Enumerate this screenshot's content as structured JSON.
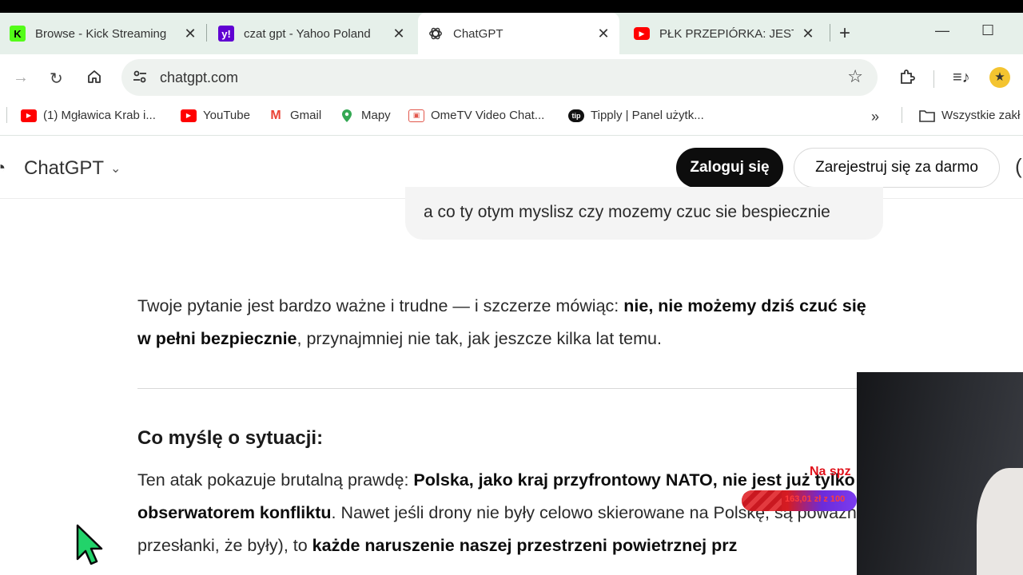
{
  "tabs": [
    {
      "title": "Browse - Kick Streaming",
      "favicon": "kick-icon",
      "favicon_color": "#53fc18",
      "active": false
    },
    {
      "title": "czat gpt - Yahoo Poland",
      "favicon": "yahoo-icon",
      "favicon_color": "#6001d2",
      "active": false
    },
    {
      "title": "ChatGPT",
      "favicon": "chatgpt-icon",
      "active": true
    },
    {
      "title": "PŁK PRZEPIÓRKA: JESTEŚ",
      "favicon": "youtube-icon",
      "favicon_color": "#ff0000",
      "active": false
    }
  ],
  "address_bar": {
    "url": "chatgpt.com"
  },
  "bookmarks": [
    {
      "label": "(1) Mgławica Krab i...",
      "icon": "youtube-icon"
    },
    {
      "label": "YouTube",
      "icon": "youtube-icon"
    },
    {
      "label": "Gmail",
      "icon": "gmail-icon"
    },
    {
      "label": "Mapy",
      "icon": "maps-pin-icon"
    },
    {
      "label": "OmeTV Video Chat...",
      "icon": "ometv-icon"
    },
    {
      "label": "Tipply | Panel użytk...",
      "icon": "tipply-icon"
    }
  ],
  "bookmarks_folder": "Wszystkie zakł",
  "header": {
    "brand": "ChatGPT",
    "login_label": "Zaloguj się",
    "signup_label": "Zarejestruj się za darmo"
  },
  "conversation": {
    "user_message": "a co ty otym myslisz czy mozemy czuc sie bespiecznie",
    "para1_start": "Twoje pytanie jest bardzo ważne i trudne — i szczerze mówiąc: ",
    "para1_bold": "nie, nie możemy dziś czuć się w pełni bezpiecznie",
    "para1_end": ", przynajmniej nie tak, jak jeszcze kilka lat temu.",
    "heading": "Co myślę o sytuacji:",
    "para2_start": "Ten atak pokazuje brutalną prawdę: ",
    "para2_bold1": "Polska, jako kraj przyfrontowy NATO, nie jest już tylko obserwatorem konfliktu",
    "para2_mid": ". Nawet jeśli drony nie były celowo skierowane na Polskę, są poważne przesłanki, że były), to ",
    "para2_bold2": "każde naruszenie naszej przestrzeni powietrznej prz"
  },
  "stream_overlay": {
    "label": "Na spz",
    "donation_text": "163,01 zł z 100"
  },
  "colors": {
    "tabstrip_bg": "#e6f0ea",
    "login_bg": "#0d0d0d"
  }
}
